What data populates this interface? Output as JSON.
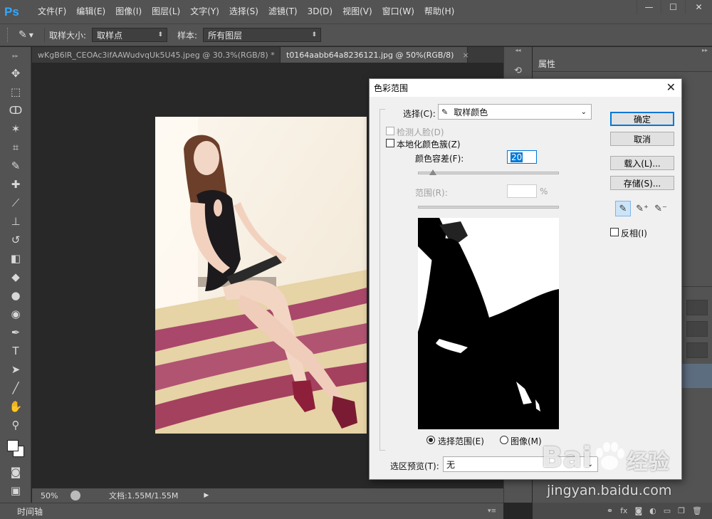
{
  "app": {
    "logo": "Ps"
  },
  "menu": [
    "文件(F)",
    "编辑(E)",
    "图像(I)",
    "图层(L)",
    "文字(Y)",
    "选择(S)",
    "滤镜(T)",
    "3D(D)",
    "视图(V)",
    "窗口(W)",
    "帮助(H)"
  ],
  "window_controls": {
    "minimize": "—",
    "restore": "☐",
    "close": "✕"
  },
  "options": {
    "sample_size_label": "取样大小:",
    "sample_size_value": "取样点",
    "sample_label": "样本:",
    "sample_value": "所有图层"
  },
  "tabs": [
    {
      "label": "wKgB6lR_CEOAc3ifAAWudvqUk5U45.jpeg @ 30.3%(RGB/8) *",
      "close": "×"
    },
    {
      "label": "t0164aabb64a8236121.jpg @ 50%(RGB/8)",
      "close": "×"
    }
  ],
  "status": {
    "zoom": "50%",
    "doc": "文档:1.55M/1.55M"
  },
  "timeline": {
    "label": "时间轴"
  },
  "right_panel": {
    "tab": "属性"
  },
  "dialog": {
    "title": "色彩范围",
    "select_label": "选择(C):",
    "select_value": "取样颜色",
    "detect_faces": "检测人脸(D)",
    "localized": "本地化颜色簇(Z)",
    "fuzziness_label": "颜色容差(F):",
    "fuzziness_value": "20",
    "range_label": "范围(R):",
    "range_unit": "%",
    "radio_selection": "选择范围(E)",
    "radio_image": "图像(M)",
    "preview_label": "选区预览(T):",
    "preview_value": "无",
    "ok": "确定",
    "cancel": "取消",
    "load": "载入(L)...",
    "save": "存储(S)...",
    "invert": "反相(I)"
  },
  "watermark": {
    "brand": "Bai",
    "brand2": "经验",
    "url": "jingyan.baidu.com"
  },
  "colors": {
    "ps_blue": "#31a8ff",
    "panel": "#535353",
    "dialog_bg": "#f0f0f0",
    "accent": "#0078d7"
  }
}
